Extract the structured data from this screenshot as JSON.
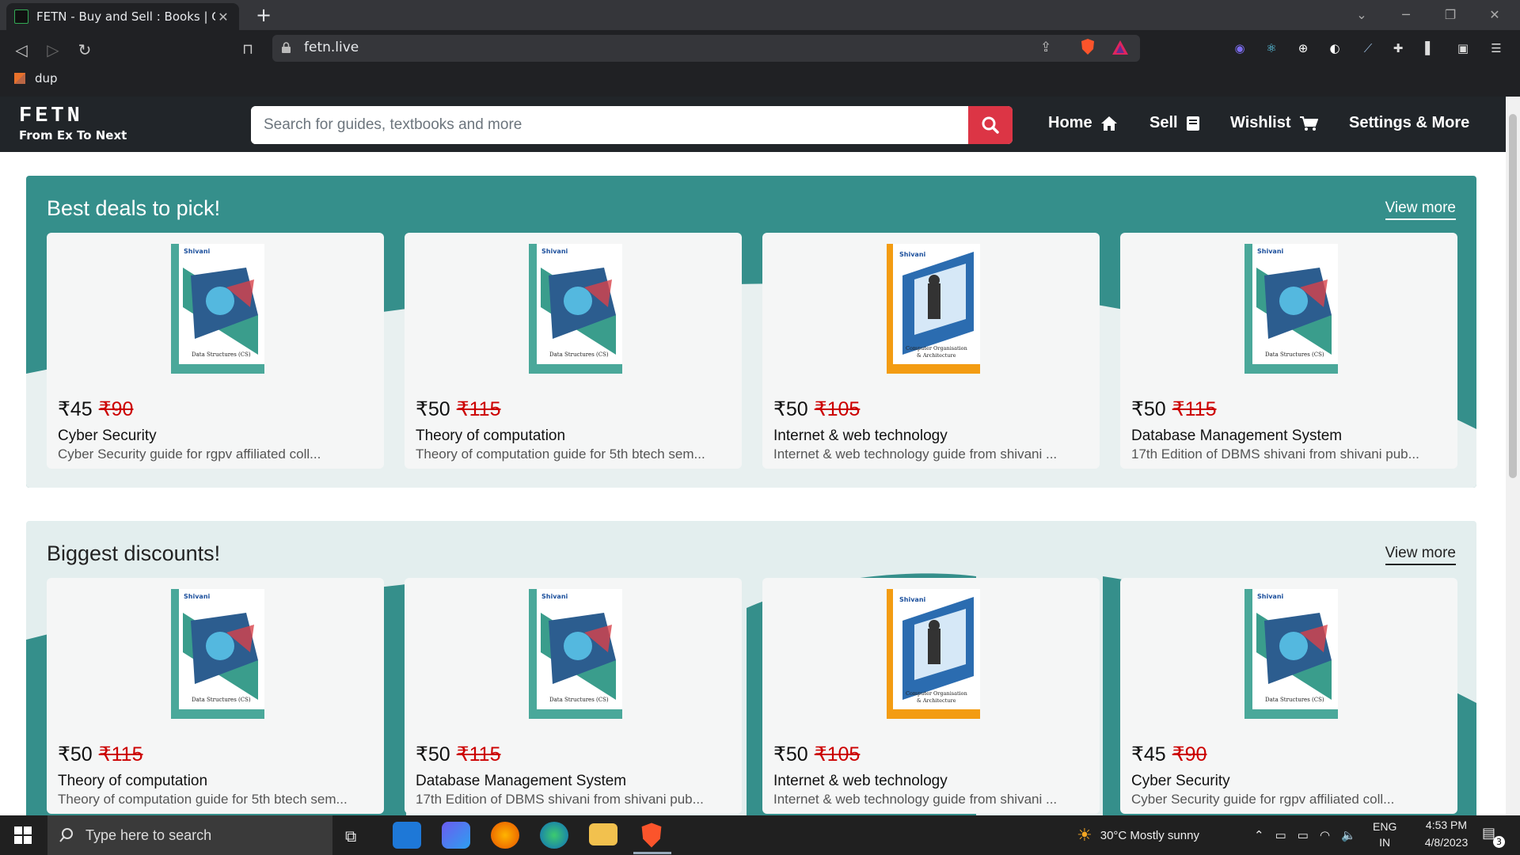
{
  "browser": {
    "tab_title": "FETN - Buy and Sell : Books | Guid",
    "url": "fetn.live",
    "bookmark": "dup"
  },
  "site": {
    "logo_title": "FETN",
    "logo_subtitle": "From Ex To Next",
    "search_placeholder": "Search for guides, textbooks and more",
    "nav": {
      "home": "Home",
      "sell": "Sell",
      "wishlist": "Wishlist",
      "settings": "Settings & More"
    }
  },
  "sections": [
    {
      "title": "Best deals to pick!",
      "view_more": "View more",
      "cards": [
        {
          "price": "₹45",
          "old_price": "₹90",
          "title": "Cyber Security",
          "desc": "Cyber Security guide for rgpv affiliated coll...",
          "cover": "ds"
        },
        {
          "price": "₹50",
          "old_price": "₹115",
          "title": "Theory of computation",
          "desc": "Theory of computation guide for 5th btech sem...",
          "cover": "ds"
        },
        {
          "price": "₹50",
          "old_price": "₹105",
          "title": "Internet & web technology",
          "desc": "Internet & web technology guide from shivani ...",
          "cover": "coa"
        },
        {
          "price": "₹50",
          "old_price": "₹115",
          "title": "Database Management System",
          "desc": "17th Edition of DBMS shivani from shivani pub...",
          "cover": "ds"
        }
      ]
    },
    {
      "title": "Biggest discounts!",
      "view_more": "View more",
      "cards": [
        {
          "price": "₹50",
          "old_price": "₹115",
          "title": "Theory of computation",
          "desc": "Theory of computation guide for 5th btech sem...",
          "cover": "ds"
        },
        {
          "price": "₹50",
          "old_price": "₹115",
          "title": "Database Management System",
          "desc": "17th Edition of DBMS shivani from shivani pub...",
          "cover": "ds"
        },
        {
          "price": "₹50",
          "old_price": "₹105",
          "title": "Internet & web technology",
          "desc": "Internet & web technology guide from shivani ...",
          "cover": "coa"
        },
        {
          "price": "₹45",
          "old_price": "₹90",
          "title": "Cyber Security",
          "desc": "Cyber Security guide for rgpv affiliated coll...",
          "cover": "ds"
        }
      ]
    }
  ],
  "covers": {
    "ds": {
      "brand": "Shivani",
      "subject": "Data Structures (CS)"
    },
    "coa": {
      "brand": "Shivani",
      "subject": "Computer Organisation & Architecture"
    }
  },
  "taskbar": {
    "search_placeholder": "Type here to search",
    "weather": "30°C  Mostly sunny",
    "lang_1": "ENG",
    "lang_2": "IN",
    "time": "4:53 PM",
    "date": "4/8/2023",
    "notifications": "3"
  },
  "colors": {
    "teal": "#358f8b",
    "light_section": "#e3eeee",
    "search_button": "#dc3545",
    "navbar": "#212529"
  }
}
